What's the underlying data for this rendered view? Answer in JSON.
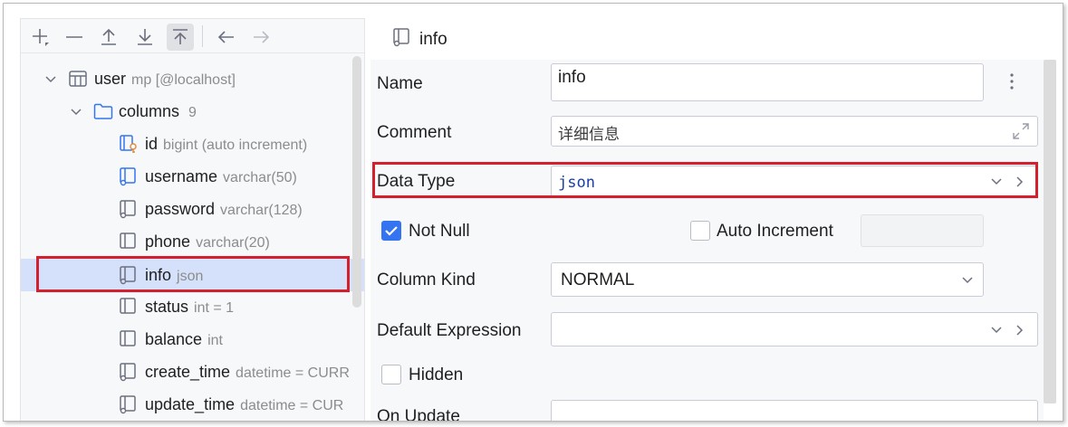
{
  "toolbar": {
    "buttons": [
      "add-icon",
      "remove-icon",
      "move-up-icon",
      "move-down-icon",
      "move-top-icon",
      "back-arrow-icon",
      "forward-arrow-icon"
    ]
  },
  "tree": {
    "table": {
      "name": "user",
      "meta": "mp [@localhost]"
    },
    "columns_folder": {
      "name": "columns",
      "count": "9"
    },
    "columns": [
      {
        "name": "id",
        "meta": "bigint (auto increment)",
        "icon": "primary-key-column-icon"
      },
      {
        "name": "username",
        "meta": "varchar(50)",
        "icon": "column-icon"
      },
      {
        "name": "password",
        "meta": "varchar(128)",
        "icon": "column-icon"
      },
      {
        "name": "phone",
        "meta": "varchar(20)",
        "icon": "column-icon"
      },
      {
        "name": "info",
        "meta": "json",
        "icon": "column-icon",
        "selected": true
      },
      {
        "name": "status",
        "meta": "int = 1",
        "icon": "column-icon"
      },
      {
        "name": "balance",
        "meta": "int",
        "icon": "column-icon"
      },
      {
        "name": "create_time",
        "meta": "datetime = CURR",
        "icon": "column-icon"
      },
      {
        "name": "update_time",
        "meta": "datetime = CUR",
        "icon": "column-icon"
      }
    ]
  },
  "editor": {
    "title": "info",
    "name_label": "Name",
    "name_value": "info",
    "comment_label": "Comment",
    "comment_value": "详细信息",
    "data_type_label": "Data Type",
    "data_type_value": "json",
    "not_null_label": "Not Null",
    "not_null_checked": true,
    "auto_increment_label": "Auto Increment",
    "auto_increment_checked": false,
    "column_kind_label": "Column Kind",
    "column_kind_value": "NORMAL",
    "default_expression_label": "Default Expression",
    "default_expression_value": "",
    "hidden_label": "Hidden",
    "hidden_checked": false,
    "on_update_label": "On Update"
  },
  "colors": {
    "selection": "#d5e1fa",
    "highlight_border": "#d4202e",
    "checkbox_checked": "#3574f0",
    "data_type_text": "#1a3ea8"
  }
}
